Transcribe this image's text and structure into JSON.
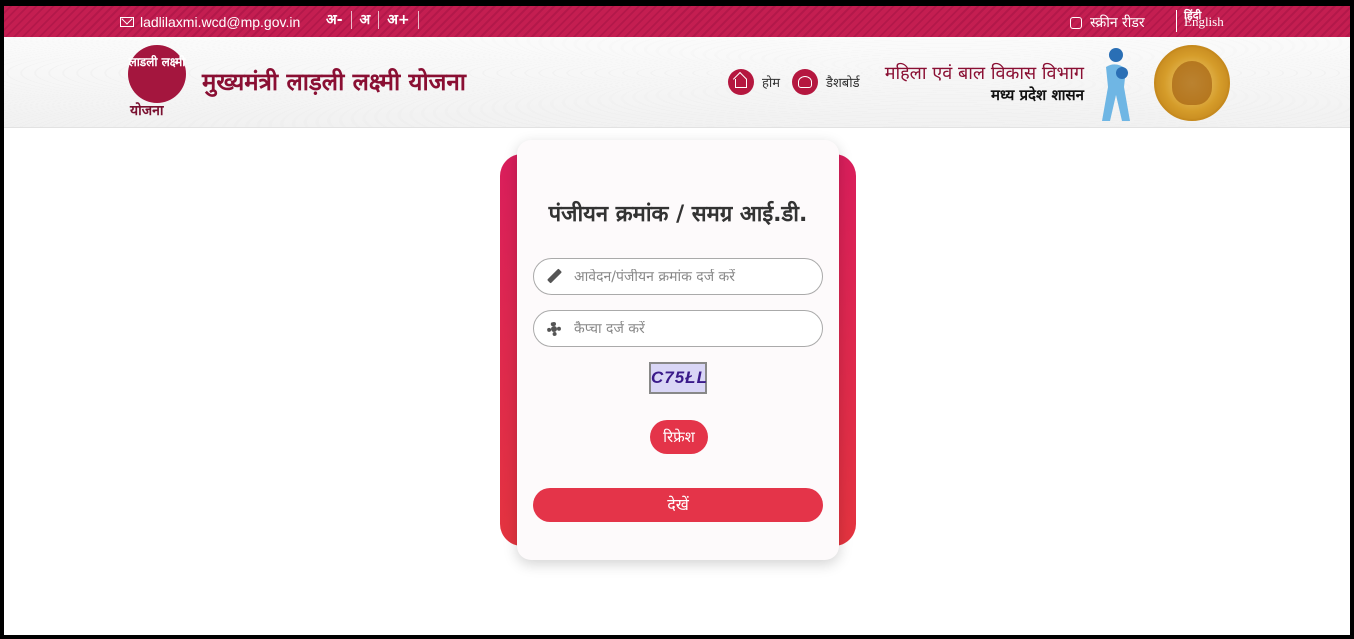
{
  "topbar": {
    "email": "ladlilaxmi.wcd@mp.gov.in",
    "font_decrease": "अ-",
    "font_normal": "अ",
    "font_increase": "अ+",
    "screen_reader": "स्क्रीन रीडर",
    "language": "English",
    "language_icon_text": "हिंदी"
  },
  "header": {
    "logo_text_top": "लाडली लक्ष्मी",
    "logo_text_bottom": "योजना",
    "title": "मुख्यमंत्री लाड़ली लक्ष्मी योजना",
    "nav": [
      {
        "label": "होम",
        "icon": "home-icon"
      },
      {
        "label": "डैशबोर्ड",
        "icon": "dashboard-icon"
      }
    ],
    "dept_line1": "महिला एवं बाल विकास विभाग",
    "dept_line2": "मध्य प्रदेश शासन"
  },
  "form": {
    "title": "पंजीयन क्रमांक / समग्र आई.डी.",
    "registration_placeholder": "आवेदन/पंजीयन क्रमांक दर्ज करें",
    "registration_value": "",
    "captcha_placeholder": "कैप्चा दर्ज करें",
    "captcha_value": "",
    "captcha_text": "C75ŁL",
    "refresh_label": "रिफ्रेश",
    "submit_label": "देखें"
  },
  "colors": {
    "topbar": "#c41e51",
    "brand": "#8a0f33",
    "button": "#e43449"
  }
}
